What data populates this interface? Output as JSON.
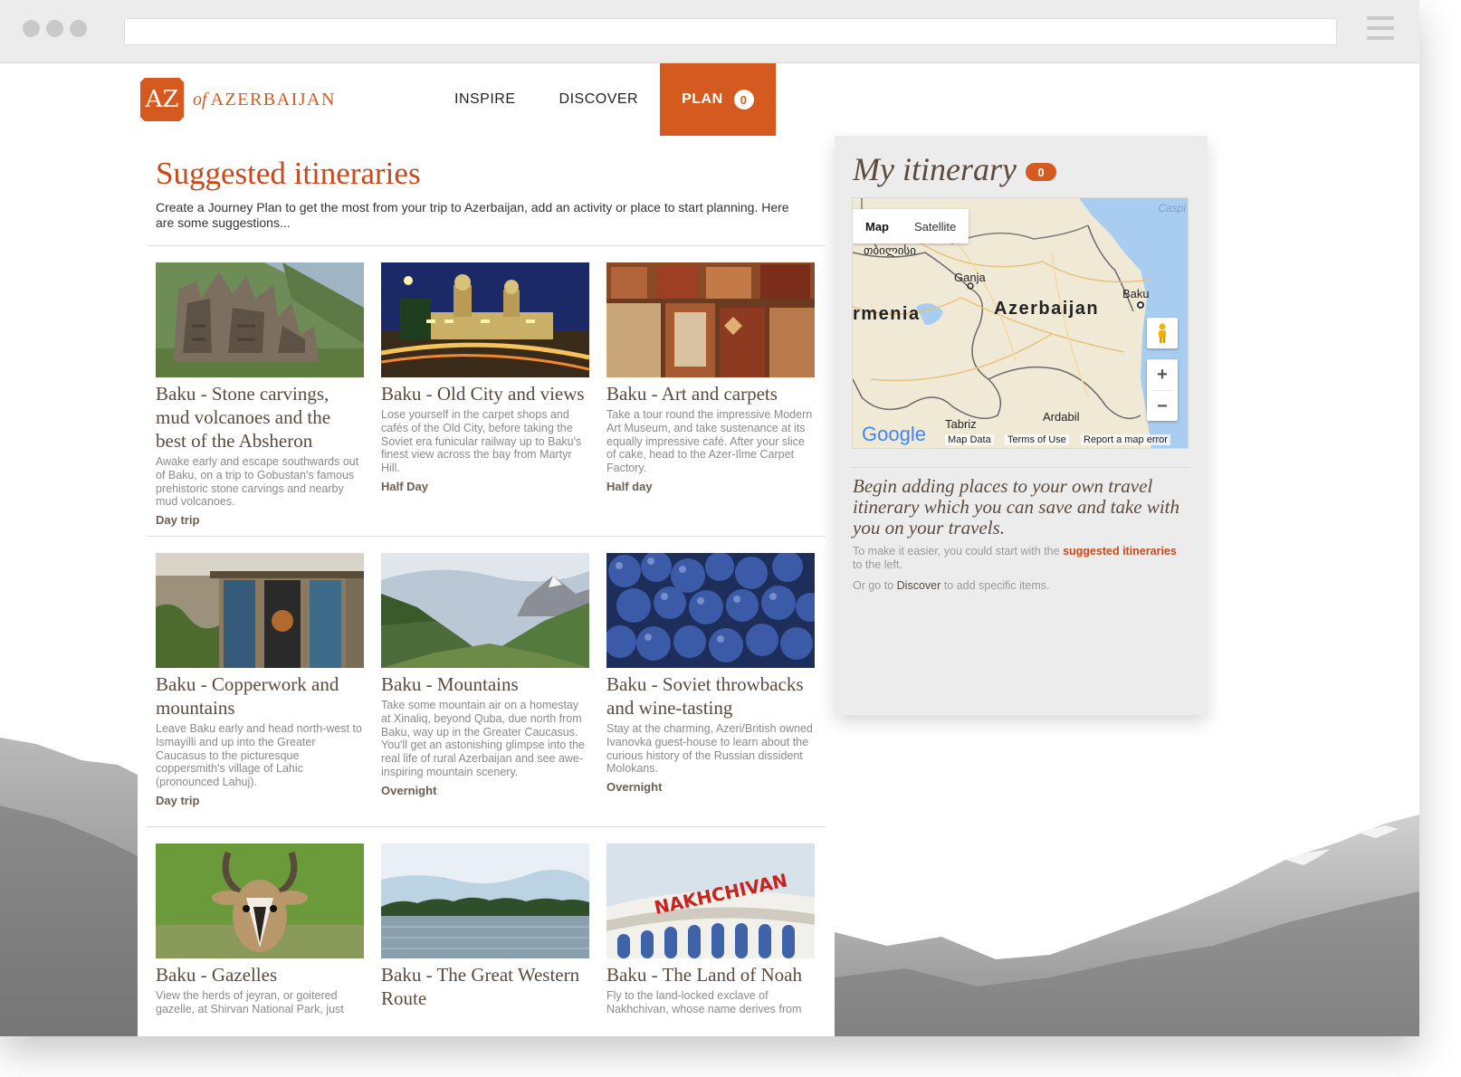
{
  "brand": {
    "mark": "AZ",
    "prefix": "of",
    "name": "AZERBAIJAN"
  },
  "nav": {
    "items": [
      {
        "label": "INSPIRE"
      },
      {
        "label": "DISCOVER"
      }
    ],
    "plan": {
      "label": "PLAN",
      "count": "0"
    }
  },
  "main": {
    "title": "Suggested itineraries",
    "intro": "Create a Journey Plan to get the most from your trip to Azerbaijan, add an activity or place to start planning. Here are some suggestions...",
    "cards": [
      {
        "title": "Baku - Stone carvings, mud volcanoes and the best of the Absheron",
        "desc": "Awake early and escape southwards out of Baku, on a trip to Gobustan's famous prehistoric stone carvings and nearby mud volcanoes.",
        "duration": "Day trip"
      },
      {
        "title": "Baku - Old City and views",
        "desc": "Lose yourself in the carpet shops and cafés of the Old City, before taking the Soviet era funicular railway up to Baku's finest view across the bay from Martyr Hill.",
        "duration": "Half Day"
      },
      {
        "title": "Baku - Art and carpets",
        "desc": "Take a tour round the impressive Modern Art Museum, and take sustenance at its equally impressive café. After your slice of cake, head to the Azer-Ilme Carpet Factory.",
        "duration": "Half day"
      },
      {
        "title": "Baku - Copperwork and mountains",
        "desc": "Leave Baku early and head north-west to Ismayilli and up into the Greater Caucasus to the picturesque coppersmith's village of Lahic (pronounced Lahuj).",
        "duration": "Day trip"
      },
      {
        "title": "Baku - Mountains",
        "desc": "Take some mountain air on a homestay at Xinaliq, beyond Quba, due north from Baku, way up in the Greater Caucasus. You'll get an astonishing glimpse into the real life of rural Azerbaijan and see awe-inspiring mountain scenery.",
        "duration": "Overnight"
      },
      {
        "title": "Baku - Soviet throwbacks and wine-tasting",
        "desc": "Stay at the charming, Azeri/British owned Ivanovka guest-house to learn about the curious history of the Russian dissident Molokans.",
        "duration": "Overnight"
      },
      {
        "title": "Baku - Gazelles",
        "desc": "View the herds of jeyran, or goitered gazelle, at Shirvan National Park, just",
        "duration": ""
      },
      {
        "title": "Baku - The Great Western Route",
        "desc": "",
        "duration": ""
      },
      {
        "title": "Baku - The Land of Noah",
        "desc": "Fly to the land-locked exclave of Nakhchivan, whose name derives from",
        "duration": ""
      }
    ],
    "nakhchivan_sign": "NAKHCHIVAN"
  },
  "sidebar": {
    "title": "My itinerary",
    "count": "0",
    "map": {
      "toggle": [
        "Map",
        "Satellite"
      ],
      "labels": {
        "caspian": "Caspi",
        "tbilisi": "თბილისი",
        "ganja": "Ganja",
        "baku": "Baku",
        "azerbaijan": "Azerbaijan",
        "armenia": "rmenia",
        "tabriz": "Tabriz",
        "ardabil": "Ardabil"
      },
      "footer": {
        "google": "Google",
        "map_data": "Map Data",
        "terms": "Terms of Use",
        "report": "Report a map error"
      },
      "zoom_in": "+",
      "zoom_out": "−"
    },
    "lead": "Begin adding places to your own travel itinerary which you can save and take with you on your travels.",
    "hint1_pre": "To make it easier, you could start with the",
    "hint1_link": "suggested itineraries",
    "hint1_post": "to the left.",
    "hint2_pre": "Or go to",
    "hint2_link": "Discover",
    "hint2_post": "to add specific items."
  }
}
